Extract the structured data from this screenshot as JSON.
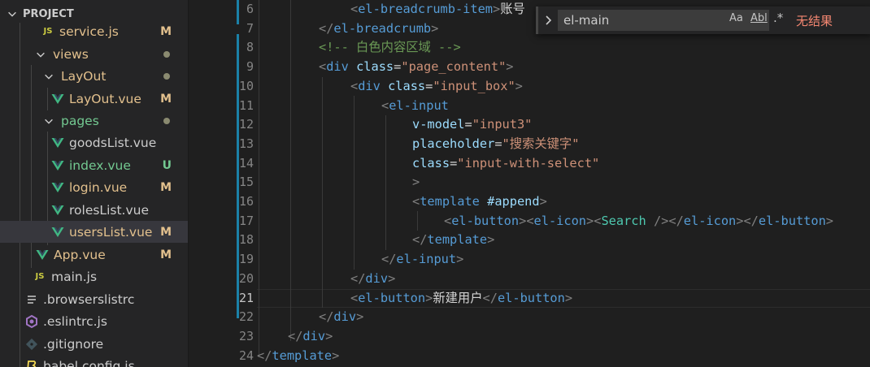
{
  "explorer": {
    "header": "PROJECT",
    "items": [
      {
        "name": "service.js",
        "type": "js",
        "badge": "M"
      },
      {
        "name": "views",
        "type": "folder",
        "badge": "dot"
      },
      {
        "name": "LayOut",
        "type": "folder",
        "badge": "dot"
      },
      {
        "name": "LayOut.vue",
        "type": "vue",
        "badge": "M"
      },
      {
        "name": "pages",
        "type": "folder",
        "badge": "dot"
      },
      {
        "name": "goodsList.vue",
        "type": "vue",
        "badge": ""
      },
      {
        "name": "index.vue",
        "type": "vue",
        "badge": "U"
      },
      {
        "name": "login.vue",
        "type": "vue",
        "badge": "M"
      },
      {
        "name": "rolesList.vue",
        "type": "vue",
        "badge": ""
      },
      {
        "name": "usersList.vue",
        "type": "vue",
        "badge": "M"
      },
      {
        "name": "App.vue",
        "type": "vue",
        "badge": "M"
      },
      {
        "name": "main.js",
        "type": "js",
        "badge": ""
      },
      {
        "name": ".browserslistrc",
        "type": "config",
        "badge": ""
      },
      {
        "name": ".eslintrc.js",
        "type": "eslint",
        "badge": ""
      },
      {
        "name": ".gitignore",
        "type": "git",
        "badge": ""
      },
      {
        "name": "babel.config.js",
        "type": "babel",
        "badge": ""
      }
    ]
  },
  "editor": {
    "line_numbers": [
      "6",
      "7",
      "8",
      "9",
      "10",
      "11",
      "12",
      "13",
      "14",
      "15",
      "16",
      "17",
      "18",
      "19",
      "20",
      "21",
      "22",
      "23",
      "24"
    ],
    "lines": [
      "<el-breadcrumb-item>账号",
      "</el-breadcrumb>",
      "<!-- 白色内容区域 -->",
      "<div class=\"page_content\">",
      "<div class=\"input_box\">",
      "<el-input",
      "v-model=\"input3\"",
      "placeholder=\"搜索关键字\"",
      "class=\"input-with-select\"",
      ">",
      "<template #append>",
      "<el-button><el-icon><Search /></el-icon></el-button>",
      "</template>",
      "</el-input>",
      "</div>",
      "<el-button>新建用户</el-button>",
      "</div>",
      "</div>",
      "</template>"
    ]
  },
  "find_widget": {
    "query": "el-main",
    "match_case": "Aa",
    "whole_word": "Abl",
    "regex": ".*",
    "result": "无结果"
  },
  "colors": {
    "modified": "#e2c08d",
    "untracked": "#73c991",
    "tag": "#569cd6",
    "attribute": "#9cdcfe",
    "string": "#ce9178",
    "comment": "#6a9955",
    "component": "#4ec9b0",
    "no_result": "#f48771"
  }
}
